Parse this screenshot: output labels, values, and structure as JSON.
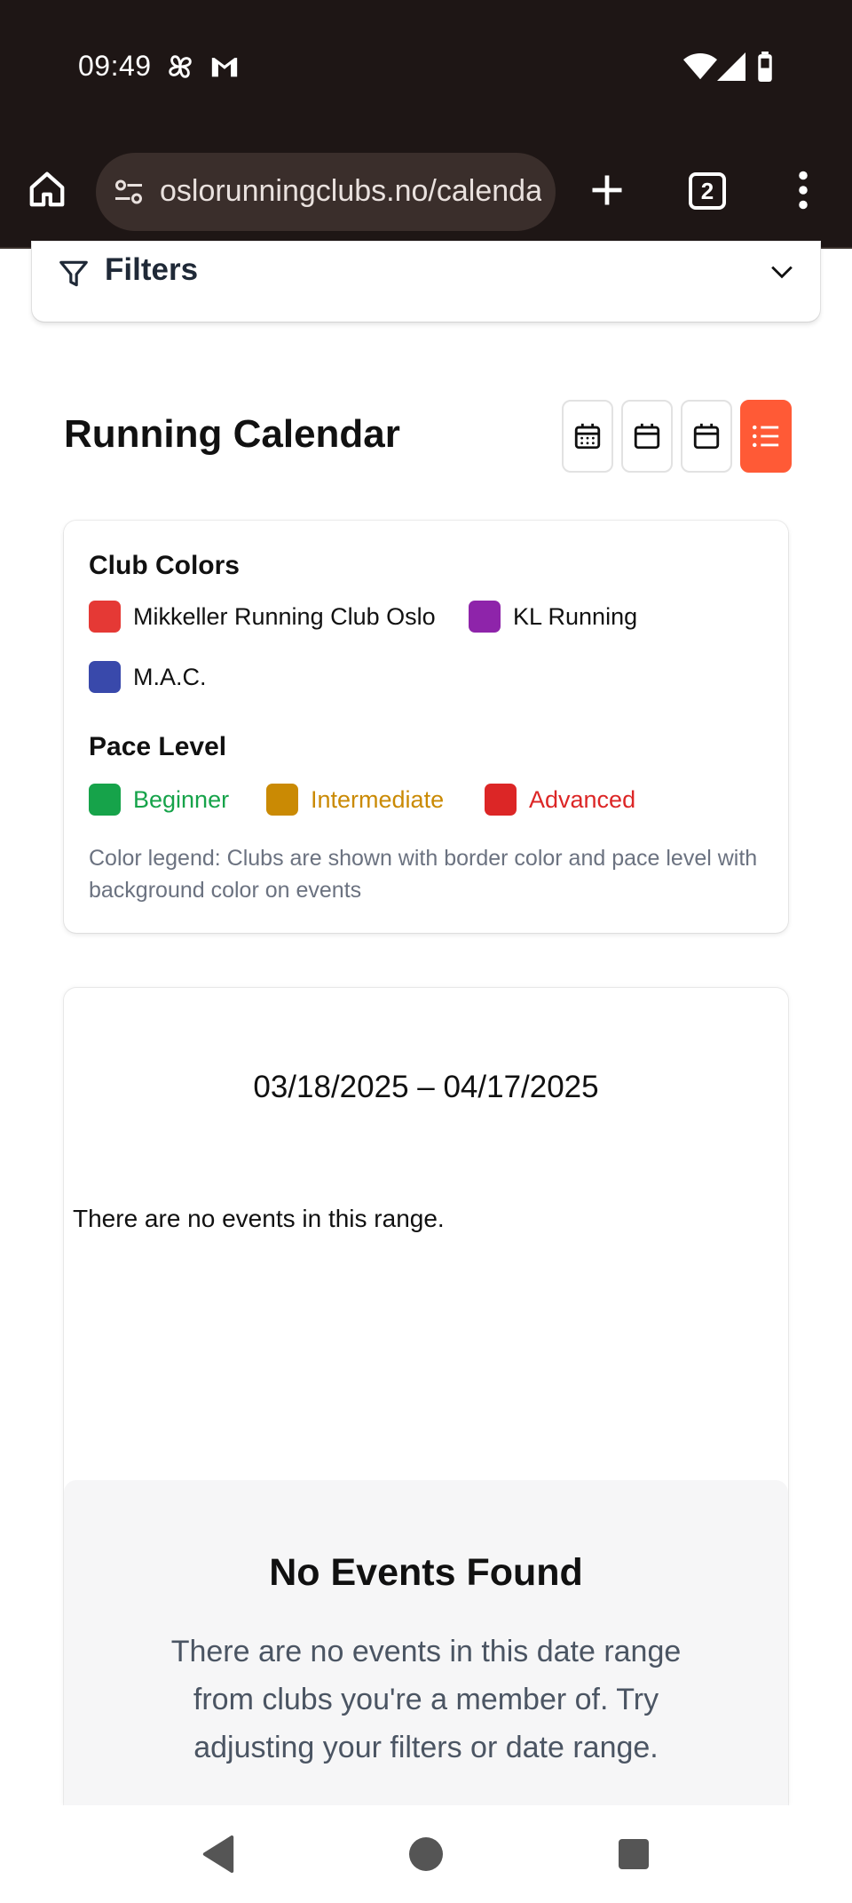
{
  "status_bar": {
    "time": "09:49",
    "icons": [
      "pinwheel-icon",
      "gmail-icon",
      "wifi-icon",
      "signal-icon",
      "battery-icon"
    ]
  },
  "browser": {
    "url": "oslorunningclubs.no/calendar",
    "tab_count": "2",
    "icons": [
      "home-icon",
      "site-settings-icon",
      "new-tab-icon",
      "tab-switcher-icon",
      "more-menu-icon"
    ]
  },
  "filters": {
    "label": "Filters",
    "expanded": false
  },
  "page": {
    "title": "Running Calendar",
    "view_buttons": [
      {
        "name": "month-view",
        "icon": "calendar-grid-icon",
        "active": false
      },
      {
        "name": "week-view",
        "icon": "calendar-icon",
        "active": false
      },
      {
        "name": "day-view",
        "icon": "calendar-icon",
        "active": false
      },
      {
        "name": "list-view",
        "icon": "list-icon",
        "active": true
      }
    ]
  },
  "legend": {
    "club_colors_title": "Club Colors",
    "clubs": [
      {
        "name": "Mikkeller Running Club Oslo",
        "color": "#e53935"
      },
      {
        "name": "KL Running",
        "color": "#8e24aa"
      },
      {
        "name": "M.A.C.",
        "color": "#3949ab"
      }
    ],
    "pace_level_title": "Pace Level",
    "paces": [
      {
        "name": "Beginner",
        "color": "#16a34a"
      },
      {
        "name": "Intermediate",
        "color": "#ca8a04"
      },
      {
        "name": "Advanced",
        "color": "#dc2626"
      }
    ],
    "note": "Color legend: Clubs are shown with border color and pace level with background color on events"
  },
  "calendar": {
    "date_range": "03/18/2025 – 04/17/2025",
    "no_events_text": "There are no events in this range."
  },
  "empty_state": {
    "heading": "No Events Found",
    "message": "There are no events in this date range from clubs you're a member of. Try adjusting your filters or date range."
  },
  "colors": {
    "accent": "#ff5a36",
    "chrome_bg": "#1e1615"
  }
}
